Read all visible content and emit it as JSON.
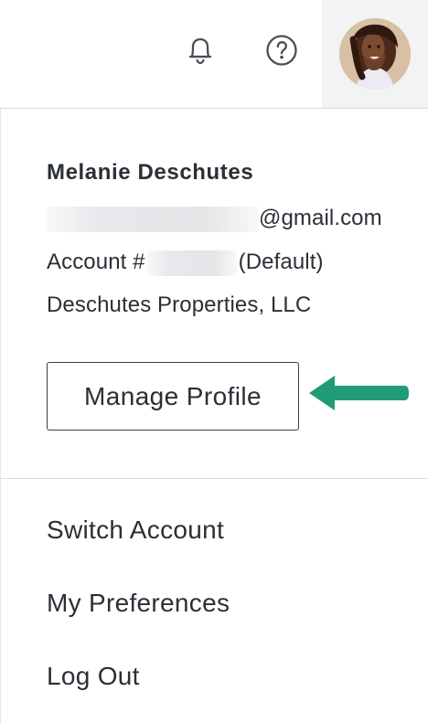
{
  "header": {
    "icons": [
      "bell-icon",
      "help-circle-icon",
      "avatar"
    ]
  },
  "profile": {
    "name": "Melanie Deschutes",
    "email_domain": "@gmail.com",
    "account_prefix": "Account #",
    "account_suffix": "(Default)",
    "company": "Deschutes Properties, LLC"
  },
  "actions": {
    "manage_profile_label": "Manage Profile"
  },
  "menu": {
    "items": [
      {
        "label": "Switch Account"
      },
      {
        "label": "My Preferences"
      },
      {
        "label": "Log Out"
      }
    ]
  },
  "colors": {
    "text": "#2b2f36",
    "divider": "#dcdcdf",
    "avatar_bg": "#f3f3f4",
    "arrow": "#1f9b78"
  }
}
